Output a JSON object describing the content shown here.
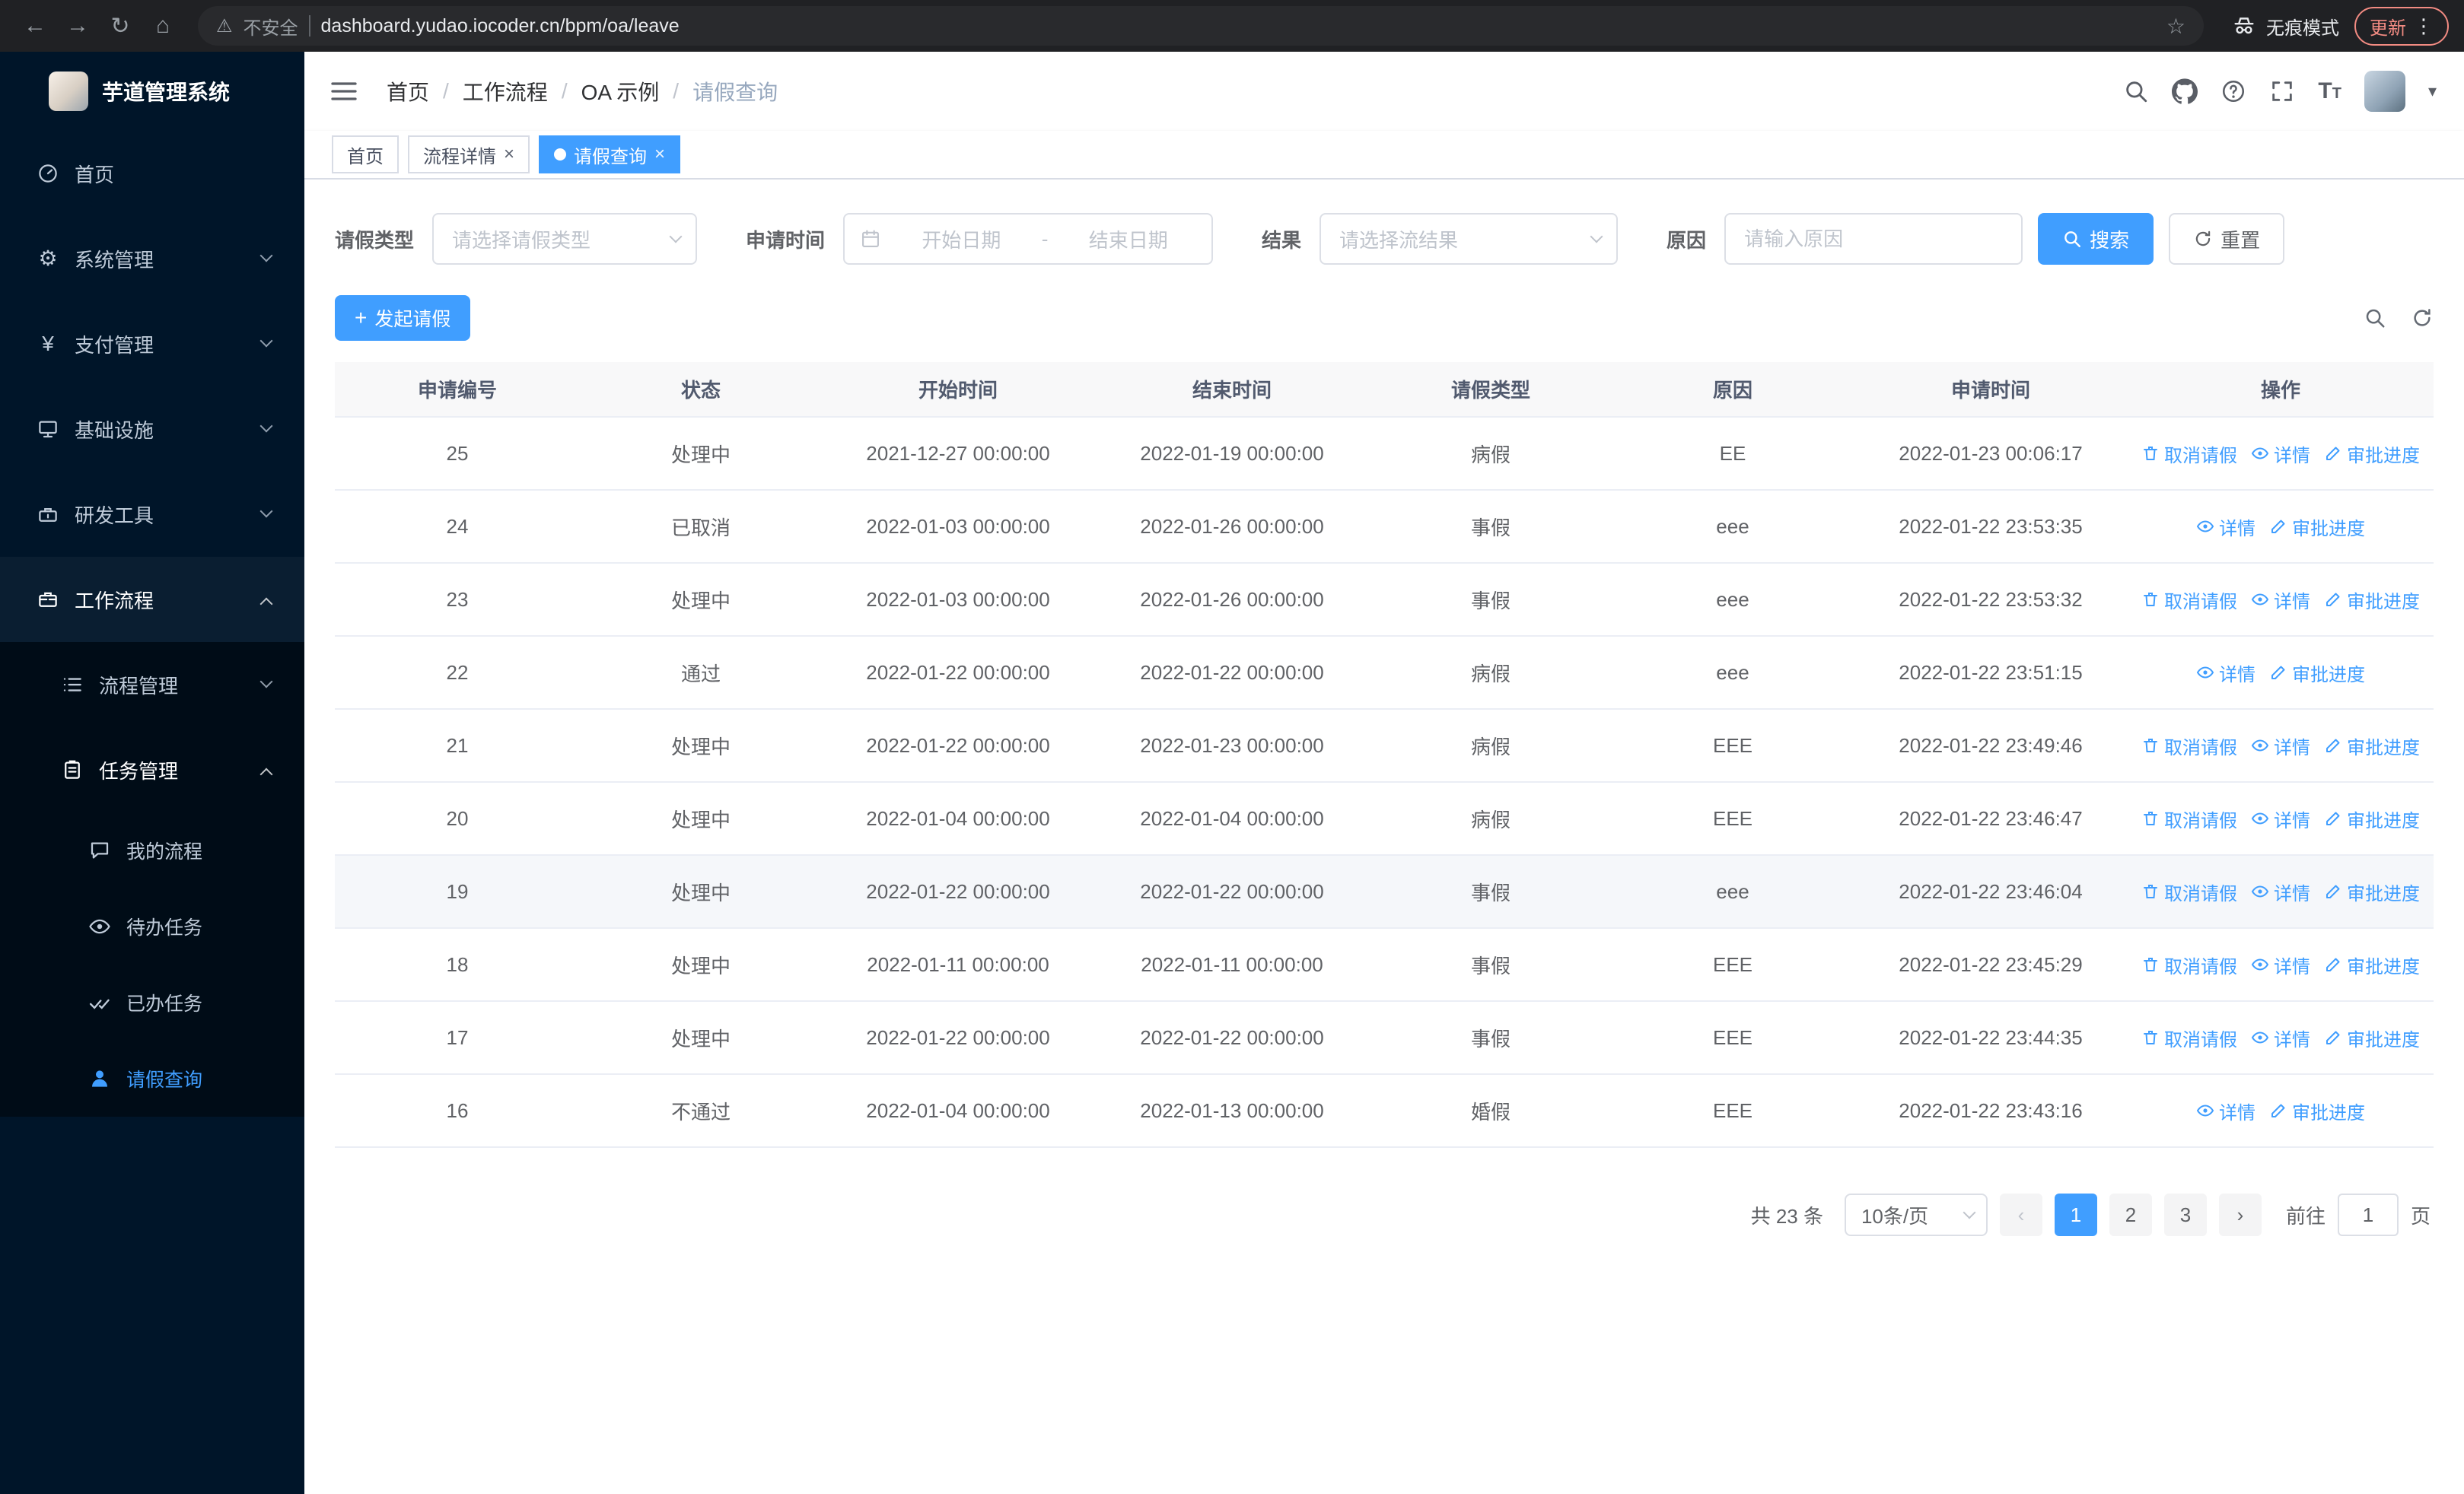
{
  "browser": {
    "security_label": "不安全",
    "url": "dashboard.yudao.iocoder.cn/bpm/oa/leave",
    "incognito_label": "无痕模式",
    "update_label": "更新"
  },
  "icons": {
    "back": "←",
    "forward": "→",
    "reload": "↻",
    "home": "⌂",
    "warning": "⚠",
    "star": "☆",
    "kebab": "⋮",
    "caret_down": "▾",
    "gear": "⚙",
    "yen": "¥",
    "plus": "+",
    "close": "×",
    "dash": "-",
    "prev": "‹",
    "next": "›",
    "font_size": "T"
  },
  "sidebar": {
    "title": "芋道管理系统",
    "menu": [
      {
        "label": "首页"
      },
      {
        "label": "系统管理"
      },
      {
        "label": "支付管理"
      },
      {
        "label": "基础设施"
      },
      {
        "label": "研发工具"
      },
      {
        "label": "工作流程"
      },
      {
        "label": "流程管理"
      },
      {
        "label": "任务管理"
      },
      {
        "label": "我的流程"
      },
      {
        "label": "待办任务"
      },
      {
        "label": "已办任务"
      },
      {
        "label": "请假查询"
      }
    ]
  },
  "header": {
    "breadcrumbs": [
      "首页",
      "工作流程",
      "OA 示例",
      "请假查询"
    ],
    "separator": "/"
  },
  "tabs": [
    {
      "label": "首页"
    },
    {
      "label": "流程详情"
    },
    {
      "label": "请假查询"
    }
  ],
  "filters": {
    "leave_type_label": "请假类型",
    "leave_type_placeholder": "请选择请假类型",
    "apply_time_label": "申请时间",
    "start_date_placeholder": "开始日期",
    "range_separator": "-",
    "end_date_placeholder": "结束日期",
    "result_label": "结果",
    "result_placeholder": "请选择流结果",
    "reason_label": "原因",
    "reason_placeholder": "请输入原因",
    "search_button": "搜索",
    "reset_button": "重置"
  },
  "toolbar": {
    "create_button": "发起请假"
  },
  "table": {
    "columns": [
      "申请编号",
      "状态",
      "开始时间",
      "结束时间",
      "请假类型",
      "原因",
      "申请时间",
      "操作"
    ],
    "action_labels": {
      "cancel": "取消请假",
      "detail": "详情",
      "progress": "审批进度"
    },
    "rows": [
      {
        "id": "25",
        "status": "处理中",
        "start": "2021-12-27 00:00:00",
        "end": "2022-01-19 00:00:00",
        "type": "病假",
        "reason": "EE",
        "applied": "2022-01-23 00:06:17",
        "actions": [
          "cancel",
          "detail",
          "progress"
        ]
      },
      {
        "id": "24",
        "status": "已取消",
        "start": "2022-01-03 00:00:00",
        "end": "2022-01-26 00:00:00",
        "type": "事假",
        "reason": "eee",
        "applied": "2022-01-22 23:53:35",
        "actions": [
          "detail",
          "progress"
        ]
      },
      {
        "id": "23",
        "status": "处理中",
        "start": "2022-01-03 00:00:00",
        "end": "2022-01-26 00:00:00",
        "type": "事假",
        "reason": "eee",
        "applied": "2022-01-22 23:53:32",
        "actions": [
          "cancel",
          "detail",
          "progress"
        ]
      },
      {
        "id": "22",
        "status": "通过",
        "start": "2022-01-22 00:00:00",
        "end": "2022-01-22 00:00:00",
        "type": "病假",
        "reason": "eee",
        "applied": "2022-01-22 23:51:15",
        "actions": [
          "detail",
          "progress"
        ]
      },
      {
        "id": "21",
        "status": "处理中",
        "start": "2022-01-22 00:00:00",
        "end": "2022-01-23 00:00:00",
        "type": "病假",
        "reason": "EEE",
        "applied": "2022-01-22 23:49:46",
        "actions": [
          "cancel",
          "detail",
          "progress"
        ]
      },
      {
        "id": "20",
        "status": "处理中",
        "start": "2022-01-04 00:00:00",
        "end": "2022-01-04 00:00:00",
        "type": "病假",
        "reason": "EEE",
        "applied": "2022-01-22 23:46:47",
        "actions": [
          "cancel",
          "detail",
          "progress"
        ]
      },
      {
        "id": "19",
        "status": "处理中",
        "start": "2022-01-22 00:00:00",
        "end": "2022-01-22 00:00:00",
        "type": "事假",
        "reason": "eee",
        "applied": "2022-01-22 23:46:04",
        "actions": [
          "cancel",
          "detail",
          "progress"
        ],
        "highlight": true
      },
      {
        "id": "18",
        "status": "处理中",
        "start": "2022-01-11 00:00:00",
        "end": "2022-01-11 00:00:00",
        "type": "事假",
        "reason": "EEE",
        "applied": "2022-01-22 23:45:29",
        "actions": [
          "cancel",
          "detail",
          "progress"
        ]
      },
      {
        "id": "17",
        "status": "处理中",
        "start": "2022-01-22 00:00:00",
        "end": "2022-01-22 00:00:00",
        "type": "事假",
        "reason": "EEE",
        "applied": "2022-01-22 23:44:35",
        "actions": [
          "cancel",
          "detail",
          "progress"
        ]
      },
      {
        "id": "16",
        "status": "不通过",
        "start": "2022-01-04 00:00:00",
        "end": "2022-01-13 00:00:00",
        "type": "婚假",
        "reason": "EEE",
        "applied": "2022-01-22 23:43:16",
        "actions": [
          "detail",
          "progress"
        ]
      }
    ]
  },
  "pagination": {
    "total_label": "共 23 条",
    "page_size": "10条/页",
    "pages": [
      "1",
      "2",
      "3"
    ],
    "goto_label": "前往",
    "goto_value": "1",
    "page_unit": "页"
  },
  "colors": {
    "primary": "#409eff",
    "sidebar_bg": "#001529",
    "submenu_bg": "#000c17"
  }
}
